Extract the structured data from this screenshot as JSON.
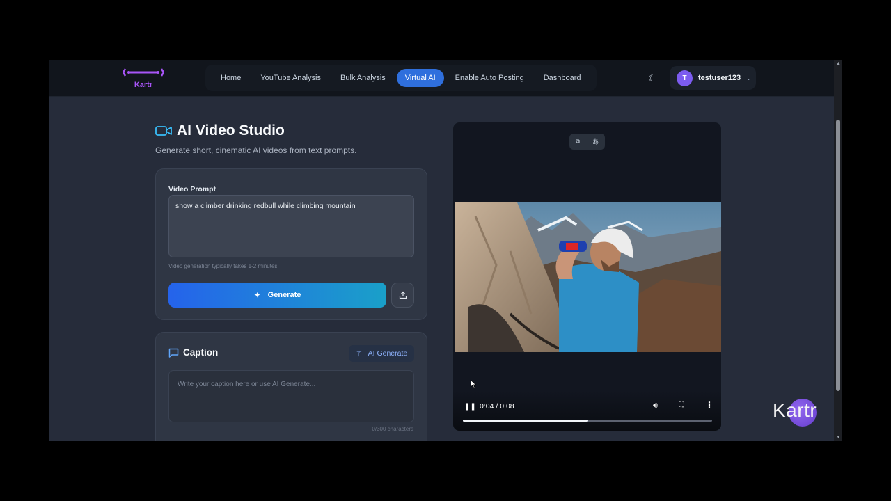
{
  "brand": {
    "name": "Kartr",
    "color": "#a855f7"
  },
  "nav": {
    "links": [
      {
        "label": "Home",
        "active": false
      },
      {
        "label": "YouTube Analysis",
        "active": false
      },
      {
        "label": "Bulk Analysis",
        "active": false
      },
      {
        "label": "Virtual AI",
        "active": true
      },
      {
        "label": "Enable Auto Posting",
        "active": false
      },
      {
        "label": "Dashboard",
        "active": false
      }
    ],
    "theme_icon": "moon-icon",
    "user": {
      "initial": "T",
      "name": "testuser123"
    }
  },
  "studio": {
    "title": "AI Video Studio",
    "subtitle": "Generate short, cinematic AI videos from text prompts."
  },
  "prompt": {
    "label": "Video Prompt",
    "value": "show a climber drinking redbull while climbing mountain",
    "hint": "Video generation typically takes 1-2 minutes.",
    "generate_label": "Generate"
  },
  "caption": {
    "title": "Caption",
    "ai_generate_label": "AI Generate",
    "placeholder": "Write your caption here or use AI Generate...",
    "char_count": "0/300 characters"
  },
  "player": {
    "time": "0:04 / 0:08",
    "progress": 0.5
  },
  "watermark": "Kartr",
  "colors": {
    "accent": "#2f6fdd",
    "avatar": "#7c5cf0"
  }
}
